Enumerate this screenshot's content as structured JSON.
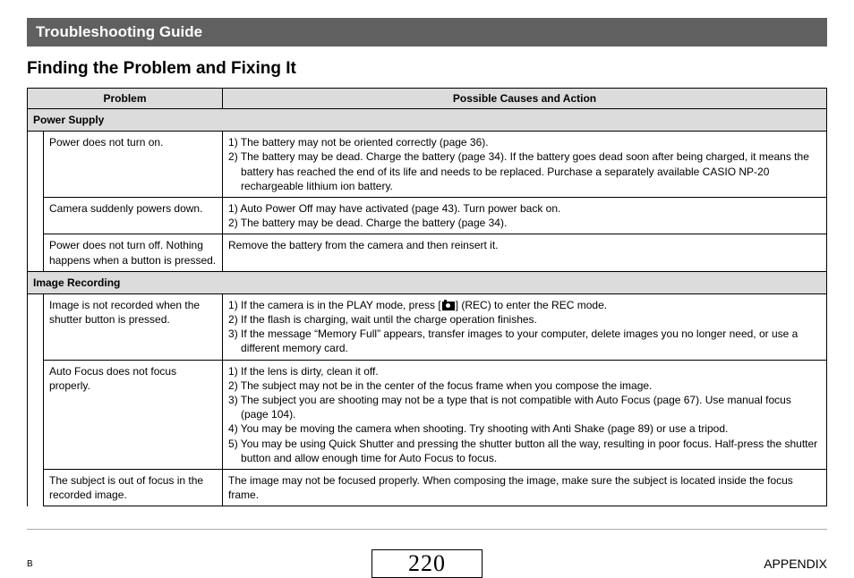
{
  "banner": "Troubleshooting Guide",
  "subheader": "Finding the Problem and Fixing It",
  "columns": {
    "problem": "Problem",
    "action": "Possible Causes and Action"
  },
  "sections": {
    "power": {
      "label": "Power Supply",
      "rows": [
        {
          "problem": "Power does not turn on.",
          "cause1": "1) The battery may not be oriented correctly (page 36).",
          "cause2": "2) The battery may be dead. Charge the battery (page 34). If the battery goes dead soon after being charged, it means the battery has reached the end of its life and needs to be replaced. Purchase a separately available CASIO NP-20 rechargeable lithium ion battery."
        },
        {
          "problem": "Camera suddenly powers down.",
          "cause1": "1) Auto Power Off may have activated (page 43). Turn power back on.",
          "cause2": "2) The battery may be dead. Charge the battery (page 34)."
        },
        {
          "problem": "Power does not turn off. Nothing happens when a button is pressed.",
          "cause1": "Remove the battery from the camera and then reinsert it."
        }
      ]
    },
    "image": {
      "label": "Image Recording",
      "rows": [
        {
          "problem": "Image is not recorded when the shutter button is pressed.",
          "cause1_pre": "1) If the camera is in the PLAY mode, press [",
          "cause1_post": "] (REC) to enter the REC mode.",
          "cause2": "2) If the flash is charging, wait until the charge operation finishes.",
          "cause3": "3) If the message “Memory Full” appears, transfer images to your computer, delete images you no longer need, or use a different memory card."
        },
        {
          "problem": "Auto Focus does not focus properly.",
          "cause1": "1) If the lens is dirty, clean it off.",
          "cause2": "2) The subject may not be in the center of the focus frame when you compose the image.",
          "cause3": "3) The subject you are shooting may not be a type that is not compatible with Auto Focus (page 67). Use manual focus (page 104).",
          "cause4": "4) You may be moving the camera when shooting. Try shooting with Anti Shake (page 89) or use a tripod.",
          "cause5": "5) You may be using Quick Shutter and pressing the shutter button all the way, resulting in poor focus. Half-press the shutter button and allow enough time for Auto Focus to focus."
        },
        {
          "problem": "The subject is out of focus in the recorded image.",
          "cause1": "The image may not be focused properly. When composing the image, make sure the subject is located inside the focus frame."
        }
      ]
    }
  },
  "footer": {
    "left": "B",
    "page": "220",
    "right": "APPENDIX"
  }
}
